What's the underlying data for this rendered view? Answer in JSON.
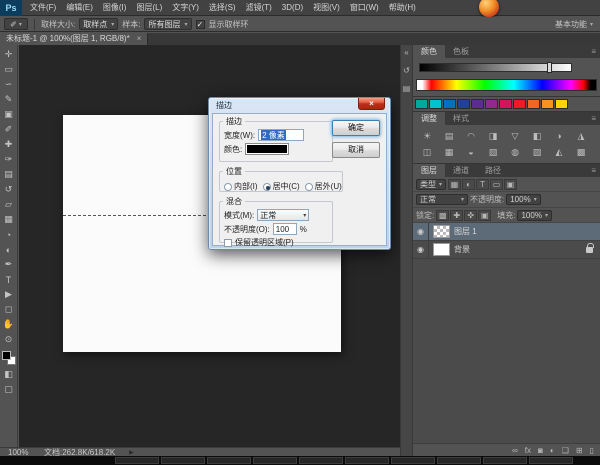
{
  "ui": {
    "caret": "▾",
    "menu_glyph": "≡",
    "x": "×",
    "check": "✓",
    "arrow": "▶",
    "eye": "◉",
    "collapse": "«"
  },
  "app": {
    "logo_text": "Ps"
  },
  "menubar": {
    "items": [
      "文件(F)",
      "编辑(E)",
      "图像(I)",
      "图层(L)",
      "文字(Y)",
      "选择(S)",
      "滤镜(T)",
      "3D(D)",
      "视图(V)",
      "窗口(W)",
      "帮助(H)"
    ]
  },
  "optionsbar": {
    "tool_glyph": "✐",
    "sample_size_label": "取样大小:",
    "sample_size_value": "取样点",
    "sample_label": "样本:",
    "sample_value": "所有图层",
    "show_ring_label": "显示取样环",
    "workspace_label": "基本功能"
  },
  "tabbar": {
    "title": "未标题-1 @ 100%(图层 1, RGB/8)*"
  },
  "tools": [
    {
      "name": "move-tool-icon",
      "glyph": "✛"
    },
    {
      "name": "marquee-tool-icon",
      "glyph": "▭"
    },
    {
      "name": "lasso-tool-icon",
      "glyph": "∽"
    },
    {
      "name": "quick-selection-tool-icon",
      "glyph": "✎"
    },
    {
      "name": "crop-tool-icon",
      "glyph": "▣"
    },
    {
      "name": "eyedropper-tool-icon",
      "glyph": "✐"
    },
    {
      "name": "healing-brush-tool-icon",
      "glyph": "✚"
    },
    {
      "name": "brush-tool-icon",
      "glyph": "✑"
    },
    {
      "name": "clone-stamp-tool-icon",
      "glyph": "▤"
    },
    {
      "name": "history-brush-tool-icon",
      "glyph": "↺"
    },
    {
      "name": "eraser-tool-icon",
      "glyph": "▱"
    },
    {
      "name": "gradient-tool-icon",
      "glyph": "▦"
    },
    {
      "name": "blur-tool-icon",
      "glyph": "◔"
    },
    {
      "name": "dodge-tool-icon",
      "glyph": "◐"
    },
    {
      "name": "pen-tool-icon",
      "glyph": "✒"
    },
    {
      "name": "type-tool-icon",
      "glyph": "T"
    },
    {
      "name": "path-selection-tool-icon",
      "glyph": "▶"
    },
    {
      "name": "shape-tool-icon",
      "glyph": "◻"
    },
    {
      "name": "hand-tool-icon",
      "glyph": "✋"
    },
    {
      "name": "zoom-tool-icon",
      "glyph": "⊙"
    }
  ],
  "tool_extras": [
    {
      "name": "quick-mask-icon",
      "glyph": "◧"
    },
    {
      "name": "screen-mode-icon",
      "glyph": "▢"
    }
  ],
  "dialog": {
    "title": "描边",
    "stroke_group": "描边",
    "width_label": "宽度(W):",
    "width_value": "2 像素",
    "color_label": "颜色:",
    "color_value": "#000000",
    "ok": "确定",
    "cancel": "取消",
    "position_group": "位置",
    "position_options": [
      "内部(I)",
      "居中(C)",
      "居外(U)"
    ],
    "position_selected": 1,
    "blend_group": "混合",
    "mode_label": "模式(M):",
    "mode_value": "正常",
    "opacity_label": "不透明度(O):",
    "opacity_value": "100",
    "percent": "%",
    "preserve_label": "保留透明区域(P)"
  },
  "dock_icons": [
    {
      "name": "collapse-panels-icon",
      "glyph": "«"
    },
    {
      "name": "history-panel-icon",
      "glyph": "↺"
    },
    {
      "name": "properties-panel-icon",
      "glyph": "▤"
    }
  ],
  "panels": {
    "color": {
      "tabs": [
        "颜色",
        "色板"
      ]
    },
    "swatches": [
      "#00a99d",
      "#00c3d0",
      "#0072bc",
      "#21409a",
      "#5c2d91",
      "#92278f",
      "#d4145a",
      "#ed1c24",
      "#f26522",
      "#f7941d",
      "#ffd400"
    ],
    "adjustments": {
      "tabs": [
        "调整",
        "样式"
      ],
      "icons": [
        {
          "name": "brightness-contrast-icon",
          "glyph": "☀"
        },
        {
          "name": "levels-icon",
          "glyph": "▤"
        },
        {
          "name": "curves-icon",
          "glyph": "◠"
        },
        {
          "name": "exposure-icon",
          "glyph": "◨"
        },
        {
          "name": "vibrance-icon",
          "glyph": "▽"
        },
        {
          "name": "hue-saturation-icon",
          "glyph": "◧"
        },
        {
          "name": "color-balance-icon",
          "glyph": "◑"
        },
        {
          "name": "black-white-icon",
          "glyph": "◮"
        },
        {
          "name": "photo-filter-icon",
          "glyph": "◫"
        },
        {
          "name": "channel-mixer-icon",
          "glyph": "▦"
        },
        {
          "name": "color-lookup-icon",
          "glyph": "◒"
        },
        {
          "name": "invert-icon",
          "glyph": "▧"
        },
        {
          "name": "posterize-icon",
          "glyph": "◍"
        },
        {
          "name": "threshold-icon",
          "glyph": "▨"
        },
        {
          "name": "gradient-map-icon",
          "glyph": "◭"
        },
        {
          "name": "selective-color-icon",
          "glyph": "▩"
        }
      ]
    },
    "layers": {
      "tabs": [
        "图层",
        "通道",
        "路径"
      ],
      "filter_value": "类型",
      "filter_icons": [
        {
          "name": "filter-pixel-icon",
          "glyph": "▦"
        },
        {
          "name": "filter-adjustment-icon",
          "glyph": "◐"
        },
        {
          "name": "filter-type-icon",
          "glyph": "T"
        },
        {
          "name": "filter-shape-icon",
          "glyph": "▭"
        },
        {
          "name": "filter-smart-object-icon",
          "glyph": "▣"
        }
      ],
      "blend_mode": "正常",
      "opacity_label": "不透明度:",
      "opacity_value": "100%",
      "lock_label": "锁定:",
      "lock_icons": [
        {
          "name": "lock-transparency-icon",
          "glyph": "▩"
        },
        {
          "name": "lock-pixels-icon",
          "glyph": "✚"
        },
        {
          "name": "lock-position-icon",
          "glyph": "✜"
        },
        {
          "name": "lock-all-icon",
          "glyph": "▣"
        }
      ],
      "fill_label": "填充:",
      "fill_value": "100%",
      "rows": [
        {
          "name": "图层 1",
          "selected": true,
          "thumb": "checker",
          "locked": false
        },
        {
          "name": "背景",
          "selected": false,
          "thumb": "white",
          "locked": true
        }
      ],
      "bottom_icons": [
        {
          "name": "link-layers-icon",
          "glyph": "∞"
        },
        {
          "name": "layer-style-icon",
          "glyph": "fx"
        },
        {
          "name": "add-layer-mask-icon",
          "glyph": "◙"
        },
        {
          "name": "new-adjustment-layer-icon",
          "glyph": "◐"
        },
        {
          "name": "new-group-icon",
          "glyph": "❏"
        },
        {
          "name": "new-layer-icon",
          "glyph": "⊞"
        },
        {
          "name": "delete-layer-icon",
          "glyph": "▯"
        }
      ]
    }
  },
  "statusbar": {
    "zoom": "100%",
    "doc_info": "文档:262.8K/618.2K"
  },
  "taskbar": {
    "item_count": 10
  }
}
